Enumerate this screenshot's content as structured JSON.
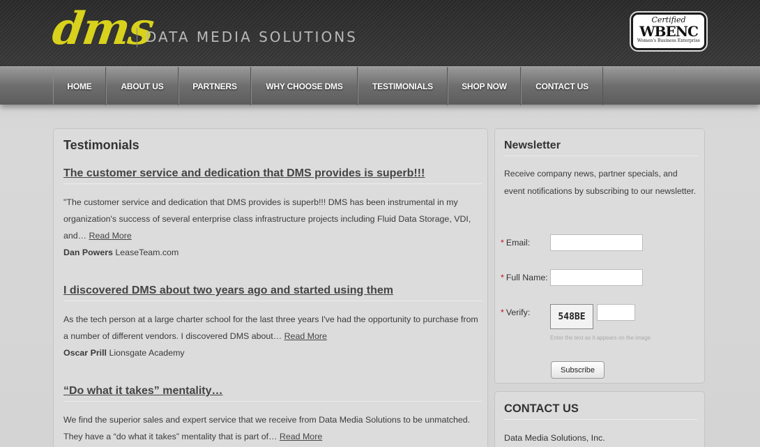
{
  "header": {
    "logo_mark": "dms",
    "logo_text": "DATA MEDIA SOLUTIONS",
    "badge": {
      "top": "Certified",
      "main": "WBENC",
      "sub": "Women's Business Enterprise"
    }
  },
  "nav": {
    "items": [
      "HOME",
      "ABOUT US",
      "PARTNERS",
      "WHY CHOOSE DMS",
      "TESTIMONIALS",
      "SHOP NOW",
      "CONTACT US"
    ]
  },
  "main": {
    "title": "Testimonials",
    "testimonials": [
      {
        "heading": "The customer service and dedication that DMS provides is superb!!!",
        "body": "\"The customer service and dedication that DMS provides is superb!!! DMS has been instrumental in my organization's success of several enterprise class infrastructure projects including Fluid Data Storage, VDI, and…",
        "read_more": "Read More",
        "author_name": "Dan Powers",
        "author_org": "LeaseTeam.com"
      },
      {
        "heading": "I discovered DMS about two years ago and started using them",
        "body": "As the tech person at a large charter school for the last three years I've had the opportunity to purchase from a number of different vendors.  I discovered DMS about…",
        "read_more": "Read More",
        "author_name": "Oscar Prill",
        "author_org": "Lionsgate Academy"
      },
      {
        "heading": "“Do what it takes” mentality…",
        "body": "We find the superior sales and expert service that we receive from Data Media Solutions to be unmatched.  They have a “do what it takes” mentality that is part of…",
        "read_more": "Read More"
      }
    ]
  },
  "newsletter": {
    "title": "Newsletter",
    "description": "Receive company news, partner specials, and event notifications by subscribing to our newsletter.",
    "required_mark": "*",
    "email_label": "Email:",
    "fullname_label": "Full Name:",
    "verify_label": "Verify:",
    "captcha_text": "548BE",
    "captcha_hint": "Enter the text as it appears on the image",
    "subscribe_label": "Subscribe"
  },
  "contact": {
    "title": "CONTACT US",
    "company": "Data Media Solutions, Inc."
  }
}
